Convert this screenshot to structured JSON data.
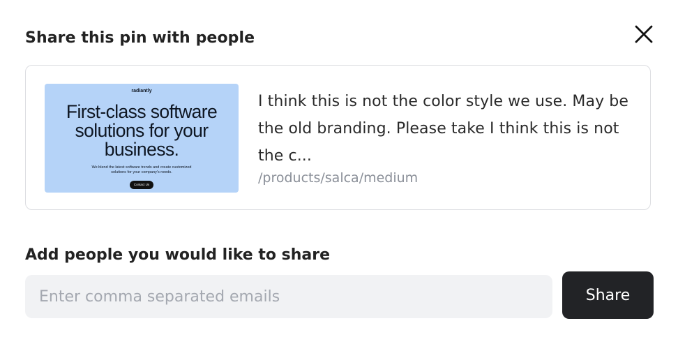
{
  "dialog": {
    "title": "Share this pin with people",
    "close_icon": "close-icon"
  },
  "pin": {
    "thumbnail": {
      "brand": "radiantly",
      "headline": "First-class software solutions for your business.",
      "subtext": "We blend the latest software trends and create customized solutions for your company's needs.",
      "button": "Contact Us",
      "background_color": "#b5d3f8"
    },
    "comment": "I think this is not the color style we use. May be the old branding. Please take I think this is not the c...",
    "path": "/products/salca/medium"
  },
  "invite": {
    "label": "Add people you would like to share",
    "email_placeholder": "Enter comma separated emails",
    "email_value": "",
    "share_label": "Share"
  },
  "colors": {
    "share_button": "#222326",
    "input_background": "#f1f2f4"
  }
}
